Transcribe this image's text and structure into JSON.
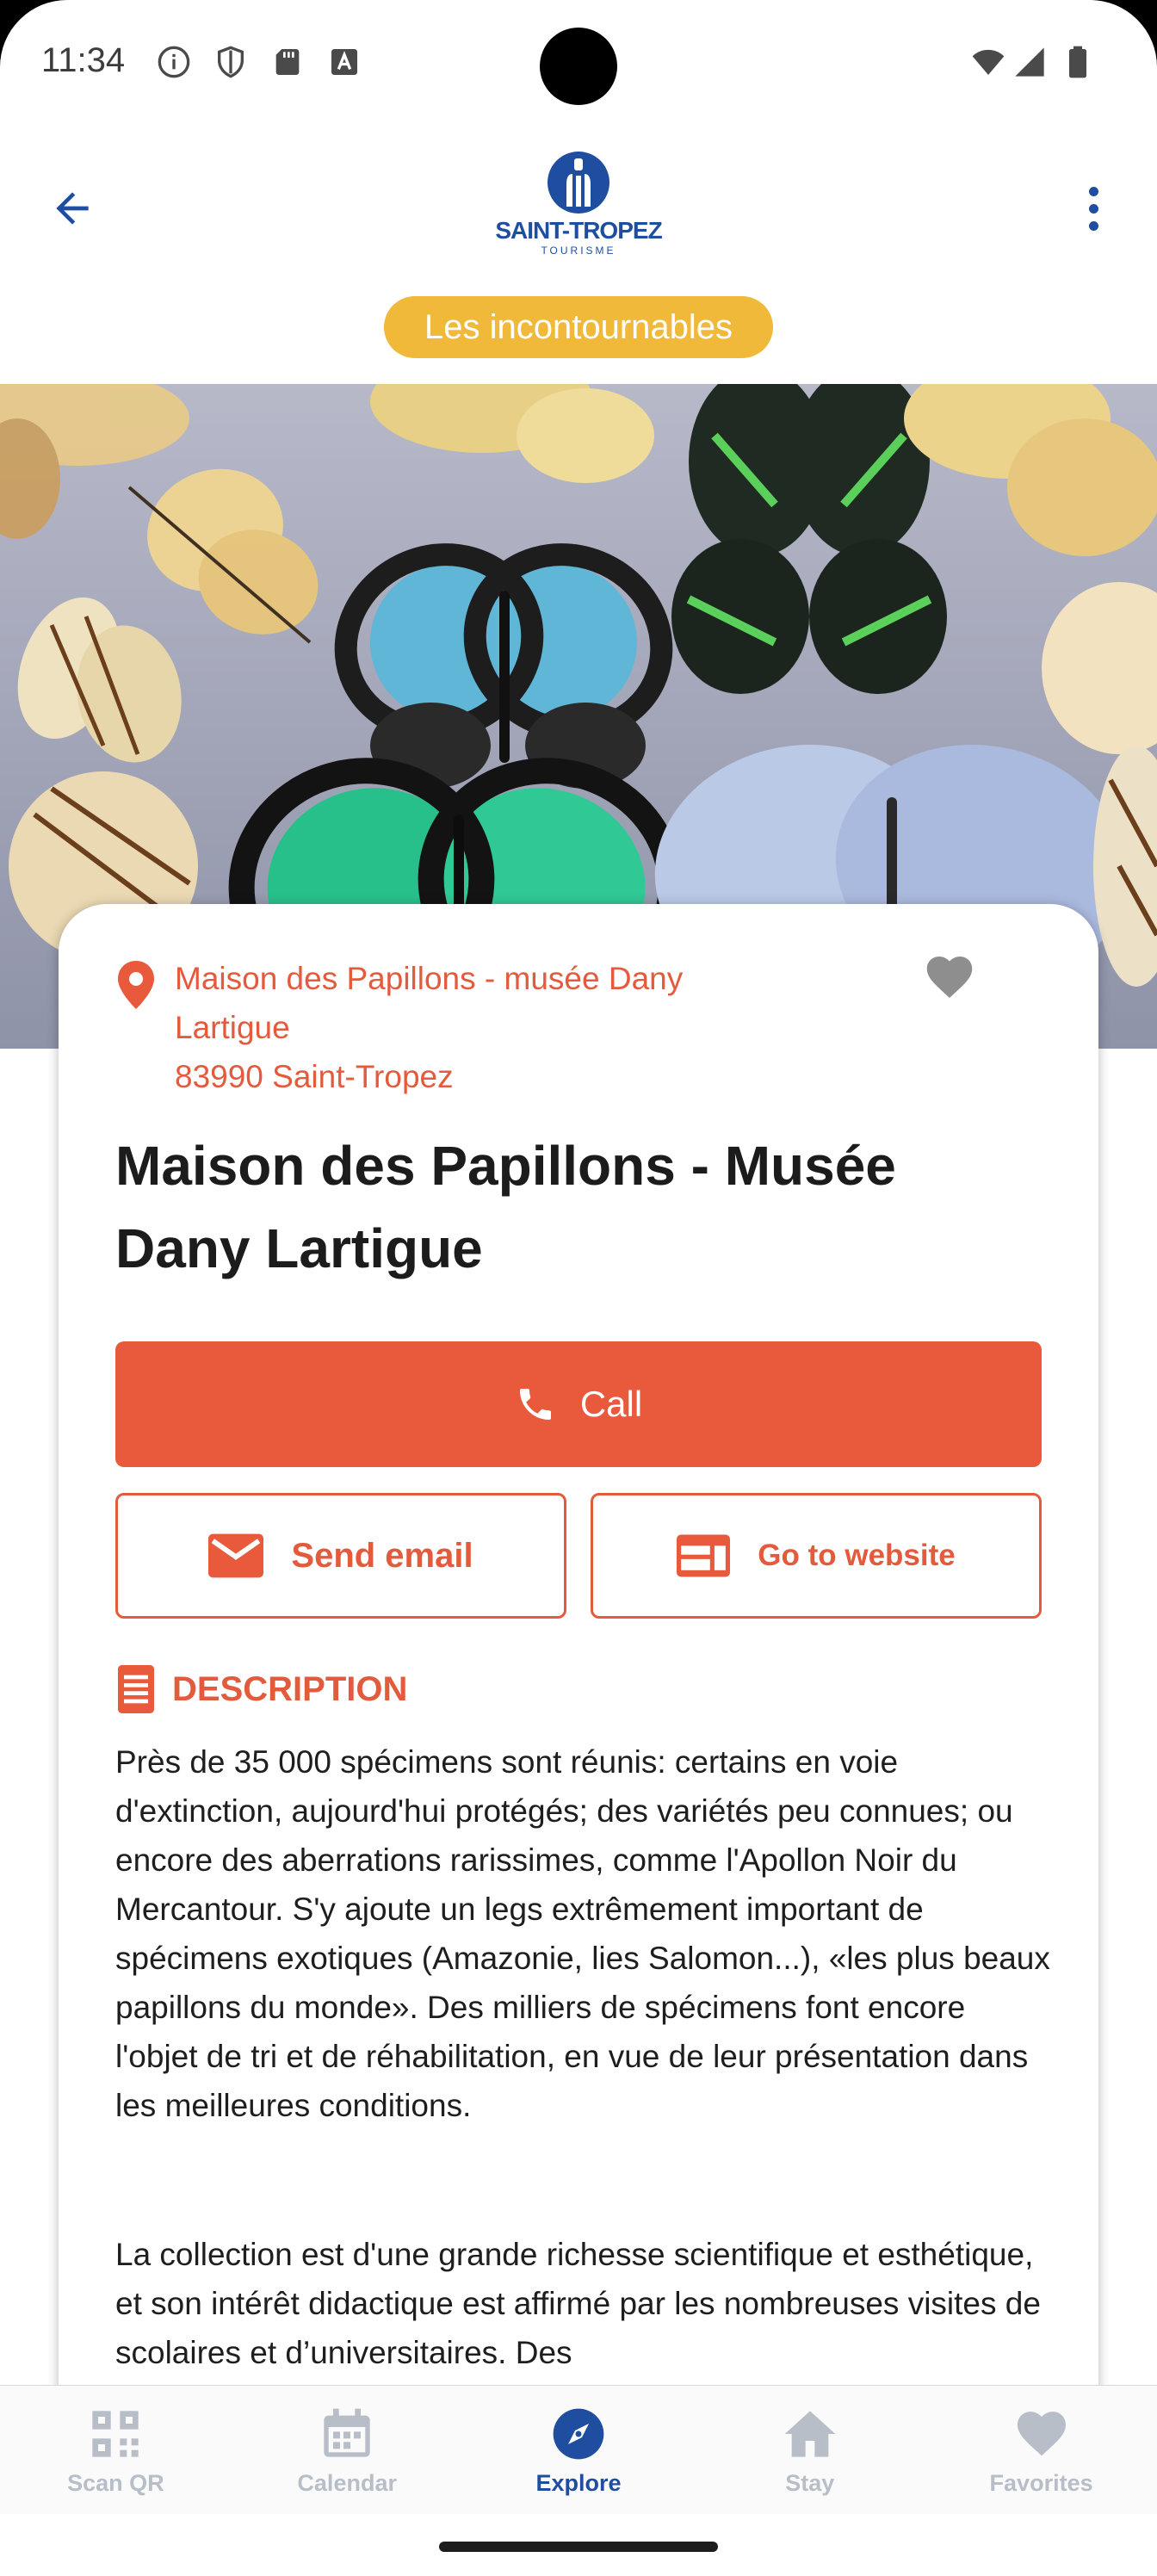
{
  "status_bar": {
    "time": "11:34",
    "left_icons": [
      "info-icon",
      "shield-icon",
      "sd-card-icon",
      "font-a-icon"
    ],
    "right_icons": [
      "wifi-icon",
      "cell-signal-icon",
      "battery-icon"
    ]
  },
  "app_bar": {
    "back_icon": "arrow-back-icon",
    "logo_title": "SAINT-TROPEZ",
    "logo_subtitle": "TOURISME",
    "more_icon": "more-vert-icon"
  },
  "category_chip": {
    "label": "Les incontournables",
    "color": "#f1b93a"
  },
  "place": {
    "address_line_1": "Maison des Papillons - musée Dany",
    "address_line_2": "Lartigue",
    "address_line_3": "83990 Saint-Tropez",
    "title": "Maison des Papillons - Musée Dany Lartigue"
  },
  "actions": {
    "call_label": "Call",
    "email_label": "Send email",
    "website_label": "Go to website"
  },
  "description": {
    "header": "DESCRIPTION",
    "paragraph_1": "Près de 35 000 spécimens sont réunis: certains en voie d'extinction, aujourd'hui protégés; des variétés peu connues; ou encore des aberrations rarissimes, comme l'Apollon Noir du Mercantour. S'y ajoute un legs extrêmement important de spécimens exotiques (Amazonie, lies Salomon...), «les plus beaux papillons du monde». Des milliers de spécimens font encore l'objet de tri et de réhabilitation, en vue de leur présentation dans les meilleures conditions.",
    "paragraph_2": "La collection est d'une grande richesse scientifique et esthétique, et son intérêt didactique est affirmé par les nombreuses visites de scolaires et d’universitaires. Des"
  },
  "bottom_nav": {
    "items": [
      {
        "label": "Scan QR",
        "icon": "qr-code-icon",
        "active": false
      },
      {
        "label": "Calendar",
        "icon": "calendar-icon",
        "active": false
      },
      {
        "label": "Explore",
        "icon": "compass-icon",
        "active": true
      },
      {
        "label": "Stay",
        "icon": "home-icon",
        "active": false
      },
      {
        "label": "Favorites",
        "icon": "heart-icon",
        "active": false
      }
    ]
  },
  "colors": {
    "accent": "#e85a3b",
    "brand_blue": "#1f4ea0",
    "chip": "#f1b93a",
    "nav_inactive": "#b8bec8"
  }
}
